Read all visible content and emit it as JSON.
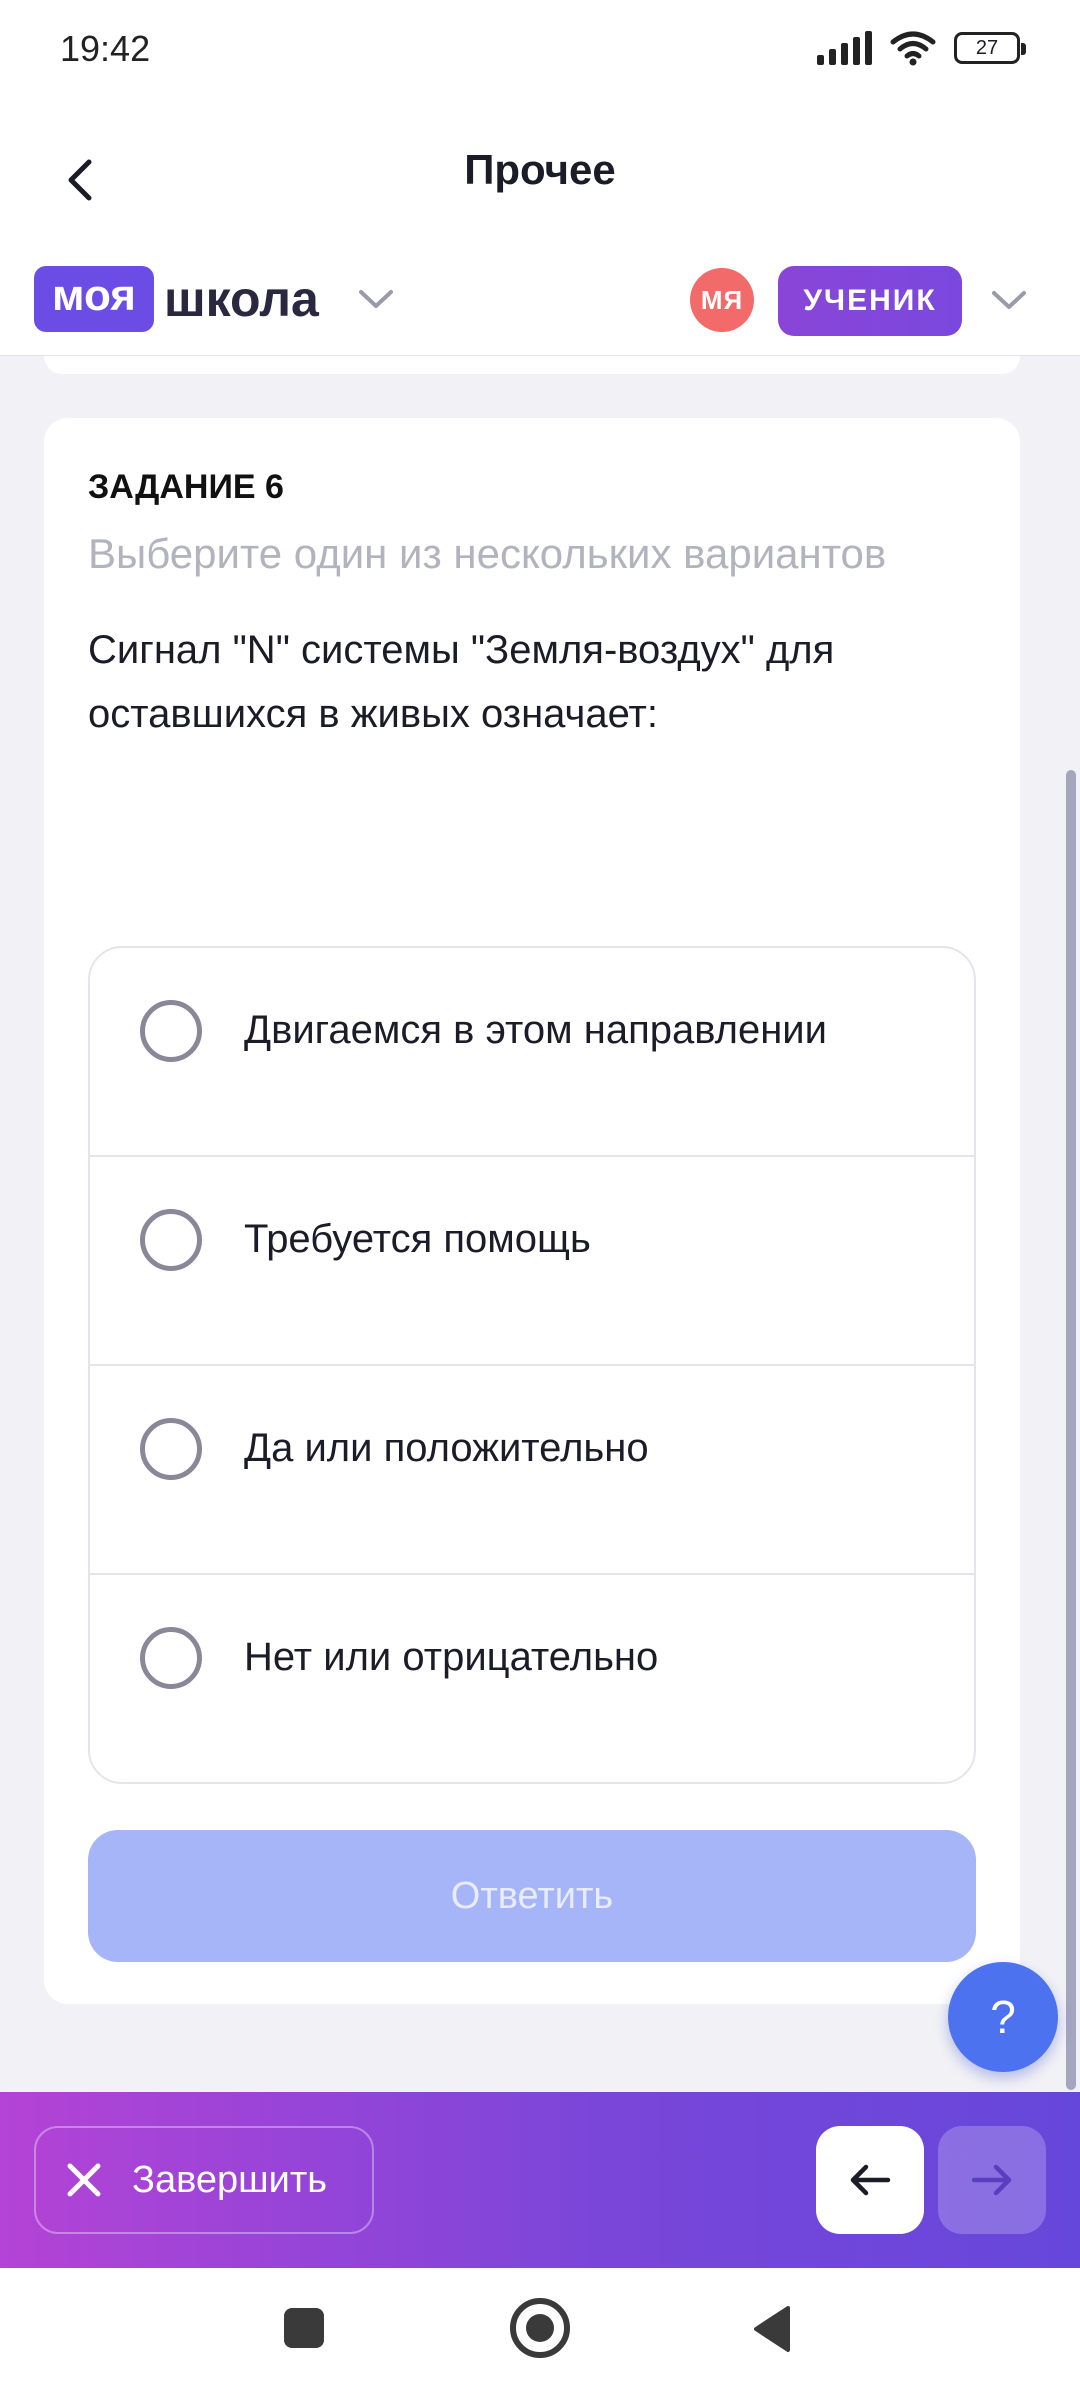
{
  "status_bar": {
    "time": "19:42",
    "battery": "27"
  },
  "header": {
    "title": "Прочее"
  },
  "logo": {
    "badge": "моя",
    "text": "школа"
  },
  "user": {
    "avatar_initials": "МЯ",
    "role": "УЧЕНИК"
  },
  "task": {
    "number_label": "ЗАДАНИЕ 6",
    "hint": "Выберите один из нескольких вариантов",
    "question": "Сигнал \"N\" системы \"Земля-воздух\" для оставшихся в живых означает:",
    "options": [
      "Двигаемся в этом направлении",
      "Требуется помощь",
      "Да или положительно",
      "Нет или отрицательно"
    ],
    "answer_label": "Ответить"
  },
  "help": {
    "label": "?"
  },
  "bottom_bar": {
    "finish_label": "Завершить"
  },
  "colors": {
    "accent": "#6b4de6",
    "role_badge": "#8a45d8",
    "avatar": "#f36a6a",
    "answer_disabled": "#a6b4f8",
    "help_fab": "#4d72f0",
    "action_bar_start": "#b443d6",
    "action_bar_end": "#6647db"
  }
}
